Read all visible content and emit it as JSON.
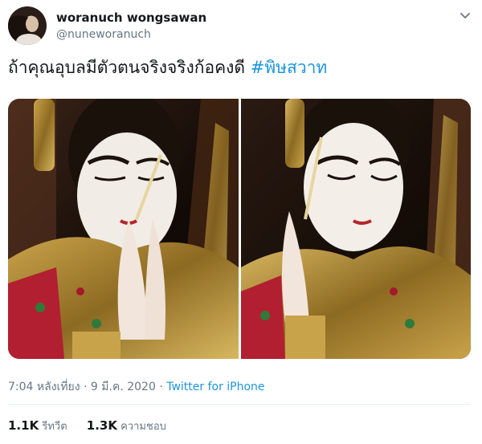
{
  "author": {
    "display_name": "woranuch wongsawan",
    "handle": "@nuneworanuch"
  },
  "tweet": {
    "text": "ถ้าคุณอุบลมีตัวตนจริงจริงก้อคงดี ",
    "hashtag": "#พิษสวาท"
  },
  "meta": {
    "time_date": "7:04 หลังเที่ยง · 9 มี.ค. 2020 · ",
    "source": "Twitter for iPhone"
  },
  "stats": {
    "retweets_count": "1.1K",
    "retweets_label": "รีทวีต",
    "likes_count": "1.3K",
    "likes_label": "ความชอบ"
  },
  "icons": {
    "caret": "chevron-down-icon"
  },
  "colors": {
    "link": "#1b95e0",
    "secondary_text": "#657786",
    "primary_text": "#14171a",
    "divider": "#e6ecf0"
  }
}
